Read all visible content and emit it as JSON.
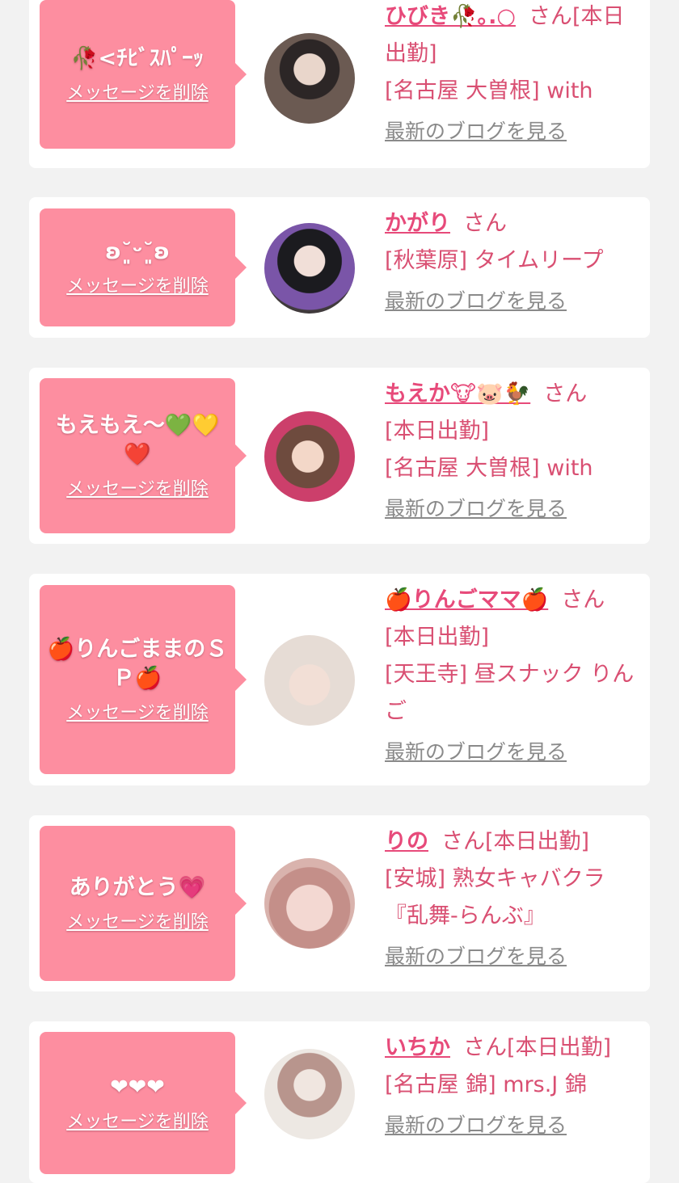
{
  "cards": [
    {
      "message": "🥀<ﾁﾋﾞｽﾊﾟｰｯ",
      "delete_label": "メッセージを削除",
      "name": "ひびき🥀｡.○",
      "san": "さん",
      "status": "[本日出勤]",
      "shop": "[名古屋 大曽根] with",
      "blog_label": "最新のブログを見る"
    },
    {
      "message": "ʚ˘͈ᵕ˘͈ʚ",
      "delete_label": "メッセージを削除",
      "name": "かがり",
      "san": "さん",
      "status": "",
      "shop": "[秋葉原] タイムリープ",
      "blog_label": "最新のブログを見る"
    },
    {
      "message": "もえもえ〜💚💛❤️",
      "delete_label": "メッセージを削除",
      "name": "もえか🐮🐷🐓",
      "san": "さん",
      "status": "[本日出勤]",
      "shop": "[名古屋 大曽根] with",
      "blog_label": "最新のブログを見る"
    },
    {
      "message": "🍎りんごままのＳＰ🍎",
      "delete_label": "メッセージを削除",
      "name": "🍎りんごママ🍎",
      "san": "さん",
      "status": "[本日出勤]",
      "shop": "[天王寺] 昼スナック りんご",
      "blog_label": "最新のブログを見る"
    },
    {
      "message": "ありがとう💗",
      "delete_label": "メッセージを削除",
      "name": "りの",
      "san": "さん",
      "status": "[本日出勤]",
      "shop": "[安城] 熟女キャバクラ『乱舞-らんぶ』",
      "blog_label": "最新のブログを見る"
    },
    {
      "message": "❤︎❤︎❤︎",
      "delete_label": "メッセージを削除",
      "name": "いちか",
      "san": "さん",
      "status": "[本日出勤]",
      "shop": "[名古屋 錦] mrs.J 錦",
      "blog_label": "最新のブログを見る"
    }
  ]
}
